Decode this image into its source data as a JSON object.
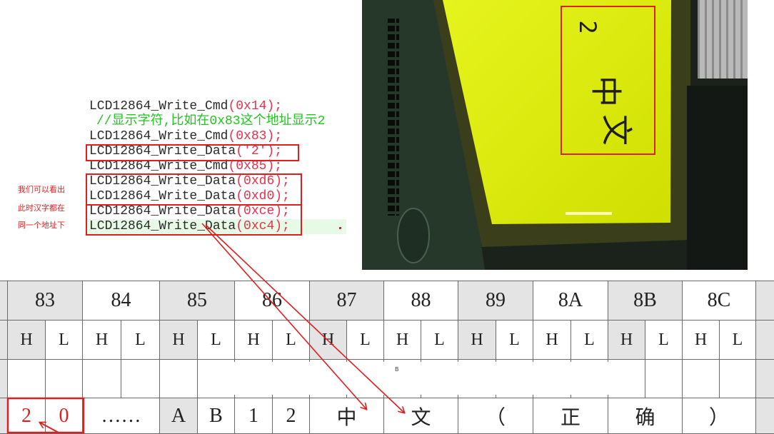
{
  "code": {
    "lines": [
      {
        "fn": "LCD12864_Write_Cmd",
        "args": "(0x14);"
      },
      {
        "text": "//显示字符,比如在0x83这个地址显示2"
      },
      {
        "fn": "LCD12864_Write_Cmd",
        "args": "(0x83);"
      },
      {
        "fn": "LCD12864_Write_Data",
        "args": "('2');"
      },
      {
        "fn": "LCD12864_Write_Cmd",
        "args": "(0x85);"
      },
      {
        "fn": "LCD12864_Write_Data",
        "args": "(0xd6);"
      },
      {
        "fn": "LCD12864_Write_Data",
        "args": "(0xd0);"
      },
      {
        "fn": "LCD12864_Write_Data",
        "args": "(0xce);"
      },
      {
        "fn": "LCD12864_Write_Data",
        "args": "(0xc4);"
      }
    ]
  },
  "annotation": {
    "lines": [
      "我们可以看出",
      "此时汉字都在",
      "同一个地址下"
    ]
  },
  "photo": {
    "lcd_chars": [
      "2",
      "中",
      "文"
    ]
  },
  "table": {
    "addresses": [
      "83",
      "84",
      "85",
      "86",
      "87",
      "88",
      "89",
      "8A",
      "8B",
      "8C"
    ],
    "half_labels": [
      "H",
      "L"
    ],
    "content_row": [
      [
        "2",
        "0"
      ],
      [
        "……"
      ],
      [
        "A",
        "B"
      ],
      [
        "1",
        "2"
      ],
      [
        "中"
      ],
      [
        "文"
      ],
      [
        "（"
      ],
      [
        "正"
      ],
      [
        "确"
      ],
      [
        "）"
      ]
    ],
    "cursor_mark": "B"
  },
  "colors": {
    "code_function": "#2b2b2b",
    "code_args": "#e8304a",
    "comment": "#22c322",
    "annotation": "#e02020",
    "highlight_box": "#e01e1e",
    "lcd_screen": "#e4f21a"
  }
}
